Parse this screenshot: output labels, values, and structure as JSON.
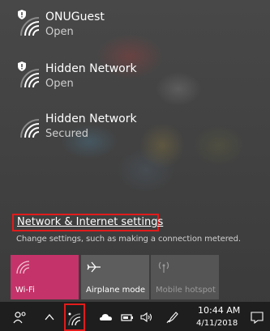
{
  "networks": [
    {
      "name": "ONUGuest",
      "status": "Open",
      "icon": "wifi-secured-warning-icon"
    },
    {
      "name": "Hidden Network",
      "status": "Open",
      "icon": "wifi-secured-warning-icon"
    },
    {
      "name": "Hidden Network",
      "status": "Secured",
      "icon": "wifi-icon"
    }
  ],
  "settings": {
    "link_label": "Network & Internet settings",
    "description": "Change settings, such as making a connection metered."
  },
  "quick_actions": [
    {
      "label": "Wi-Fi",
      "icon": "wifi-icon",
      "state": "on"
    },
    {
      "label": "Airplane mode",
      "icon": "airplane-icon",
      "state": "off"
    },
    {
      "label": "Mobile hotspot",
      "icon": "hotspot-icon",
      "state": "disabled"
    }
  ],
  "taskbar": {
    "time": "10:44 AM",
    "date": "4/11/2018"
  },
  "colors": {
    "accent": "#c43369",
    "highlight": "#e21b1b",
    "taskbar": "#1e1e1e"
  }
}
